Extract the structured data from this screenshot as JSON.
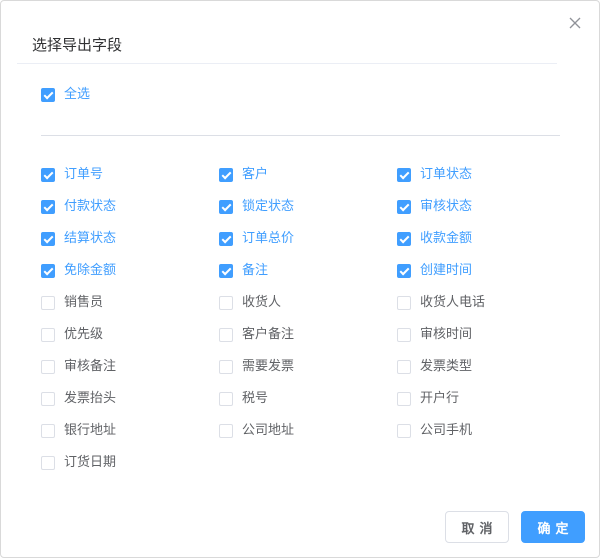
{
  "dialog": {
    "title": "选择导出字段",
    "close_icon": "close-icon"
  },
  "select_all": {
    "label": "全选",
    "checked": true
  },
  "fields": [
    {
      "label": "订单号",
      "checked": true
    },
    {
      "label": "客户",
      "checked": true
    },
    {
      "label": "订单状态",
      "checked": true
    },
    {
      "label": "付款状态",
      "checked": true
    },
    {
      "label": "锁定状态",
      "checked": true
    },
    {
      "label": "审核状态",
      "checked": true
    },
    {
      "label": "结算状态",
      "checked": true
    },
    {
      "label": "订单总价",
      "checked": true
    },
    {
      "label": "收款金额",
      "checked": true
    },
    {
      "label": "免除金额",
      "checked": true
    },
    {
      "label": "备注",
      "checked": true
    },
    {
      "label": "创建时间",
      "checked": true
    },
    {
      "label": "销售员",
      "checked": false
    },
    {
      "label": "收货人",
      "checked": false
    },
    {
      "label": "收货人电话",
      "checked": false
    },
    {
      "label": "优先级",
      "checked": false
    },
    {
      "label": "客户备注",
      "checked": false
    },
    {
      "label": "审核时间",
      "checked": false
    },
    {
      "label": "审核备注",
      "checked": false
    },
    {
      "label": "需要发票",
      "checked": false
    },
    {
      "label": "发票类型",
      "checked": false
    },
    {
      "label": "发票抬头",
      "checked": false
    },
    {
      "label": "税号",
      "checked": false
    },
    {
      "label": "开户行",
      "checked": false
    },
    {
      "label": "银行地址",
      "checked": false
    },
    {
      "label": "公司地址",
      "checked": false
    },
    {
      "label": "公司手机",
      "checked": false
    },
    {
      "label": "订货日期",
      "checked": false
    }
  ],
  "footer": {
    "cancel_label": "取消",
    "confirm_label": "确定"
  },
  "colors": {
    "accent": "#409eff",
    "text": "#606266",
    "title": "#303133",
    "border": "#dcdfe6"
  }
}
